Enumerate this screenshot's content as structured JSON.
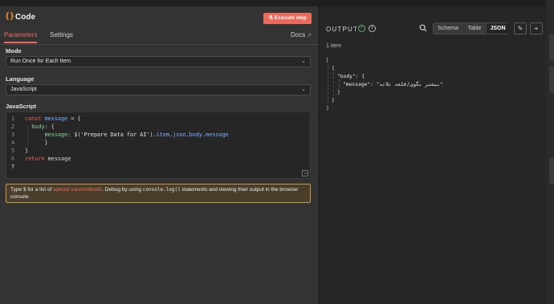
{
  "node": {
    "icon": "code-icon",
    "title": "Code",
    "execute_label": "Execute step"
  },
  "tabs": {
    "parameters": "Parameters",
    "settings": "Settings",
    "docs": "Docs"
  },
  "fields": {
    "mode_label": "Mode",
    "mode_value": "Run Once for Each Item",
    "language_label": "Language",
    "language_value": "JavaScript",
    "code_label": "JavaScript"
  },
  "code": {
    "lines": [
      {
        "n": "1",
        "text": "const message = {"
      },
      {
        "n": "2",
        "text": "  body: {"
      },
      {
        "n": "3",
        "text": "      message: $('Prepare Data for AI').item.json.body.message"
      },
      {
        "n": "4",
        "text": "  }"
      },
      {
        "n": "5",
        "text": "}"
      },
      {
        "n": "6",
        "text": "return message"
      },
      {
        "n": "7",
        "text": ""
      }
    ]
  },
  "hint": {
    "part1": "Type $ for a list of ",
    "link": "special vars/methods",
    "part2": ". Debug by using ",
    "code": "console.log()",
    "part3": " statements and viewing their output in the browser console."
  },
  "output": {
    "title": "OUTPUT",
    "items_count": "1 item",
    "views": [
      "Schema",
      "Table",
      "JSON"
    ],
    "active_view": "JSON",
    "json_lines": [
      "[",
      "{",
      "\"body\": {",
      "\"message\": \"بیشتر بگوی/قلعه ثلاثه\"",
      "}",
      "}",
      "]"
    ]
  },
  "colors": {
    "accent": "#ea6b5b",
    "success": "#5fb673",
    "warning_border": "#c79a45"
  }
}
